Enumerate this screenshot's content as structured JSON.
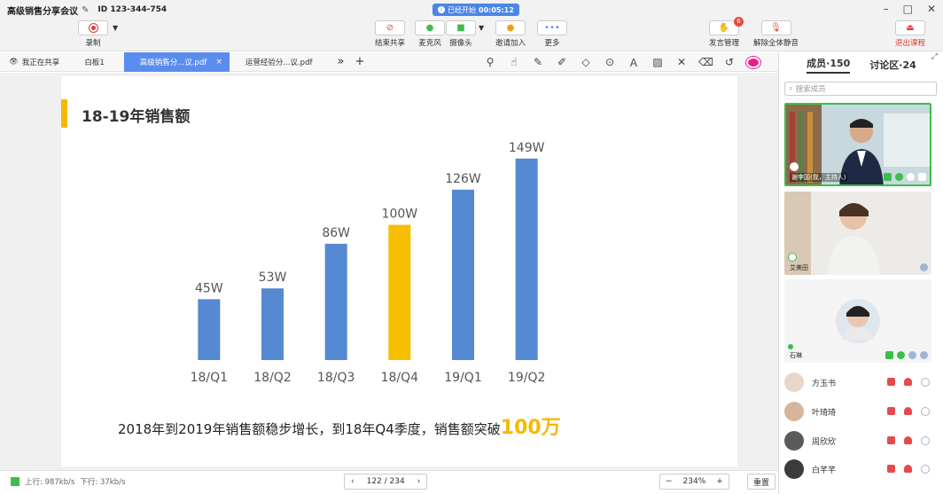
{
  "window": {
    "title": "高级销售分享会议",
    "meeting_id": "ID 123-344-754",
    "started_label": "已经开始",
    "elapsed": "00:05:12",
    "minimize": "–",
    "maximize": "□",
    "close": "✕"
  },
  "toolbar": {
    "record_label": "录制",
    "end_share_label": "结束共享",
    "mic_label": "麦克风",
    "camera_label": "摄像头",
    "invite_label": "邀请加入",
    "more_label": "更多",
    "speak_manage_label": "发言管理",
    "speak_manage_badge": "6",
    "unmute_all_label": "解除全体静音",
    "exit_label": "退出课程"
  },
  "tabs": {
    "sharing_label": "我正在共享",
    "items": [
      {
        "label": "白板1",
        "active": false
      },
      {
        "label": "高级销售分...议.pdf",
        "active": true
      },
      {
        "label": "运营经验分...议.pdf",
        "active": false
      }
    ],
    "overflow": "»",
    "add": "+"
  },
  "slide": {
    "title": "18-19年销售额",
    "summary_text": "2018年到2019年销售额稳步增长，到18年Q4季度，销售额突破",
    "summary_highlight": "100万"
  },
  "chart_data": {
    "type": "bar",
    "categories": [
      "18/Q1",
      "18/Q2",
      "18/Q3",
      "18/Q4",
      "19/Q1",
      "19/Q2"
    ],
    "values": [
      45,
      53,
      86,
      100,
      126,
      149
    ],
    "value_labels": [
      "45W",
      "53W",
      "86W",
      "100W",
      "126W",
      "149W"
    ],
    "ylim": [
      0,
      160
    ],
    "highlight_index": 3,
    "colors": {
      "default": "#5589d1",
      "highlight": "#f5bf00"
    },
    "grid": false,
    "title": "",
    "xlabel": "",
    "ylabel": ""
  },
  "status": {
    "upload": "上行: 987kb/s",
    "download": "下行: 37kb/s",
    "page": "122 / 234",
    "zoom": "234%",
    "reset_label": "重置",
    "status_color": "#3dbd4a"
  },
  "panel": {
    "members_tab": "成员·150",
    "discussion_tab": "讨论区·24",
    "search_placeholder": "搜索成员",
    "videos": [
      {
        "name": "谢李国(我，主持人)"
      },
      {
        "name": "艾美田"
      },
      {
        "name": "石琳"
      }
    ],
    "members": [
      {
        "name": "方玉书"
      },
      {
        "name": "叶琦琦"
      },
      {
        "name": "周欣欣"
      },
      {
        "name": "白芊芊"
      }
    ]
  }
}
